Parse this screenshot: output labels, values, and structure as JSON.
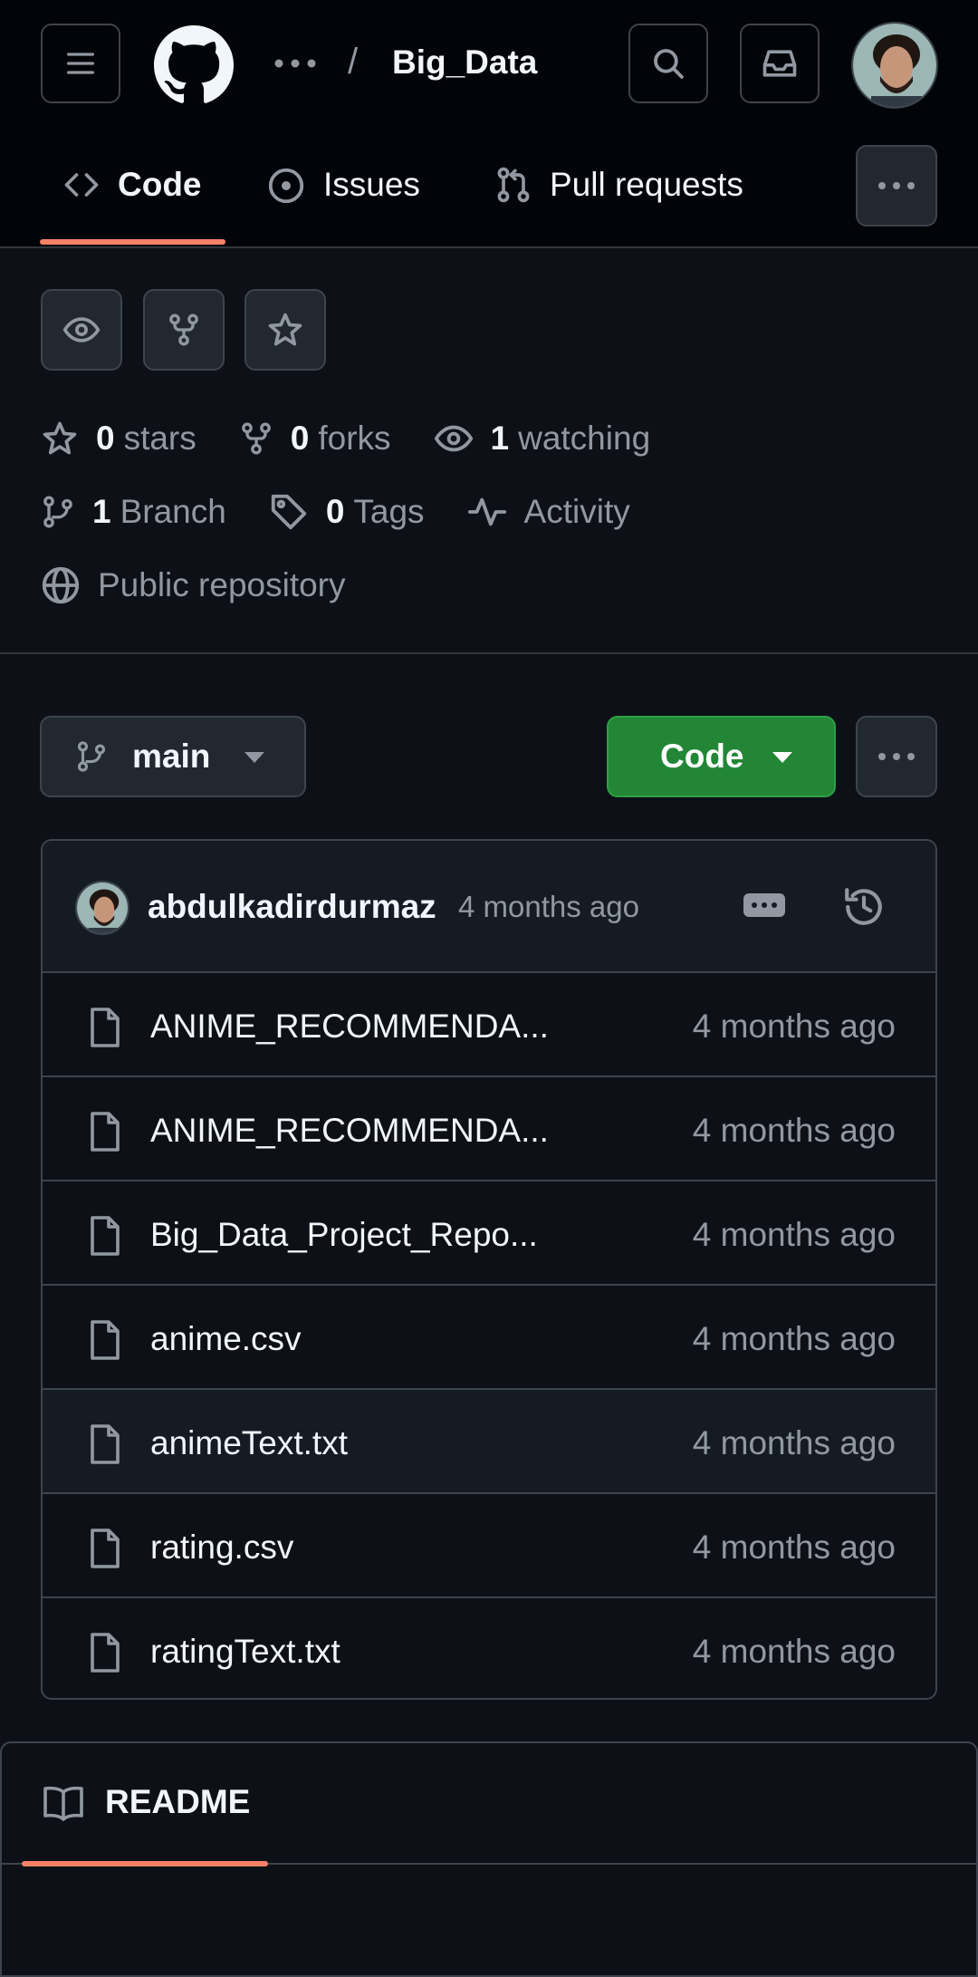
{
  "header": {
    "repo_name": "Big_Data",
    "breadcrumb_separator": "/",
    "tabs": [
      {
        "label": "Code"
      },
      {
        "label": "Issues"
      },
      {
        "label": "Pull requests"
      }
    ]
  },
  "repo_meta": {
    "stars_count": "0",
    "stars_label": "stars",
    "forks_count": "0",
    "forks_label": "forks",
    "watching_count": "1",
    "watching_label": "watching",
    "branch_count": "1",
    "branch_label": "Branch",
    "tags_count": "0",
    "tags_label": "Tags",
    "activity_label": "Activity",
    "visibility_label": "Public repository"
  },
  "toolbar": {
    "branch_label": "main",
    "code_label": "Code"
  },
  "commit": {
    "author": "abdulkadirdurmaz",
    "time": "4 months ago"
  },
  "files": [
    {
      "name": "ANIME_RECOMMENDA...",
      "time": "4 months ago"
    },
    {
      "name": "ANIME_RECOMMENDA...",
      "time": "4 months ago"
    },
    {
      "name": "Big_Data_Project_Repo...",
      "time": "4 months ago"
    },
    {
      "name": "anime.csv",
      "time": "4 months ago"
    },
    {
      "name": "animeText.txt",
      "time": "4 months ago"
    },
    {
      "name": "rating.csv",
      "time": "4 months ago"
    },
    {
      "name": "ratingText.txt",
      "time": "4 months ago"
    }
  ],
  "readme": {
    "title": "README"
  },
  "colors": {
    "background": "#0d1117",
    "header_bg": "#010409",
    "accent_underline": "#f78166",
    "code_button": "#238636",
    "muted_text": "#9198a1"
  }
}
